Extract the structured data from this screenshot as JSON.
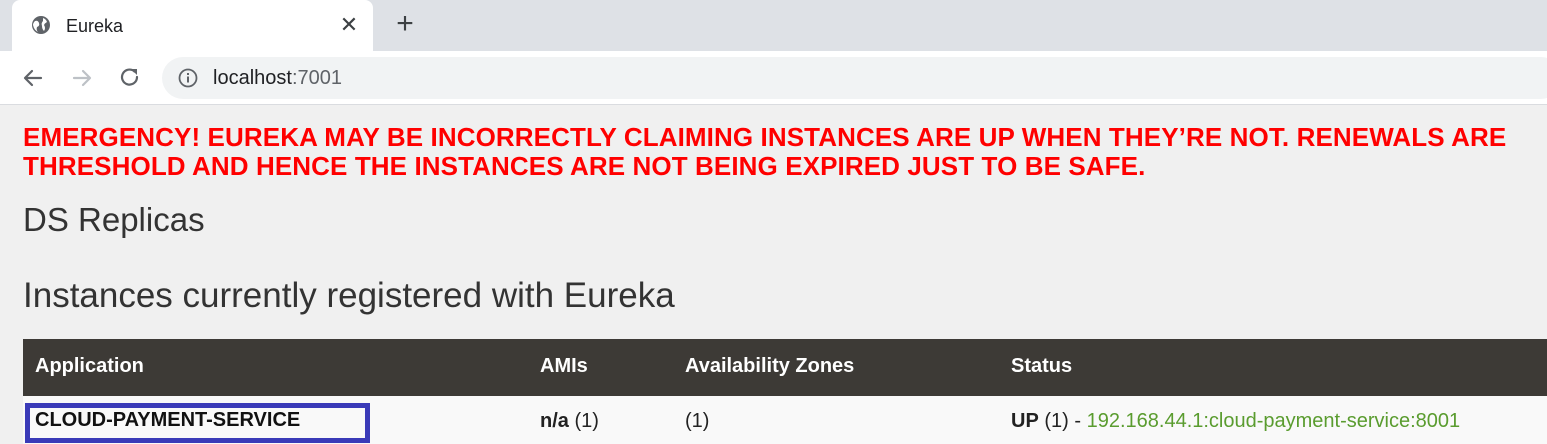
{
  "browser": {
    "tab_title": "Eureka",
    "tab_close": "✕",
    "new_tab": "+",
    "url_host": "localhost",
    "url_port": ":7001"
  },
  "page": {
    "emergency_line1": "EMERGENCY! EUREKA MAY BE INCORRECTLY CLAIMING INSTANCES ARE UP WHEN THEY’RE NOT. RENEWALS ARE",
    "emergency_line2": "THRESHOLD AND HENCE THE INSTANCES ARE NOT BEING EXPIRED JUST TO BE SAFE.",
    "ds_replicas_heading": "DS Replicas",
    "instances_heading": "Instances currently registered with Eureka",
    "emergency_color": "#ff0000",
    "table_header_color": "#3d3a36",
    "link_color": "#5a9c2f",
    "highlight_border_color": "#3a3ab8"
  },
  "table": {
    "headers": [
      "Application",
      "AMIs",
      "Availability Zones",
      "Status"
    ],
    "rows": [
      {
        "application": "CLOUD-PAYMENT-SERVICE",
        "amis_value": "n/a",
        "amis_count": "(1)",
        "zones": "(1)",
        "status_label": "UP",
        "status_count": "(1) -",
        "instance_link": "192.168.44.1:cloud-payment-service:8001"
      }
    ]
  }
}
